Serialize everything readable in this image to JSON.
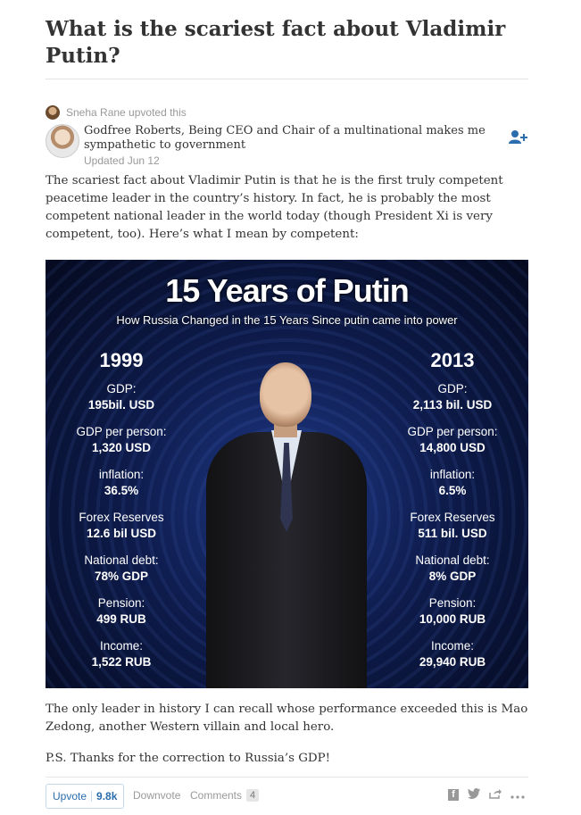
{
  "question": {
    "title": "What is the scariest fact about Vladimir Putin?"
  },
  "upvoter": {
    "text": "Sneha Rane upvoted this"
  },
  "answer": {
    "author_line": "Godfree Roberts, Being CEO and Chair of a multinational makes me sympathetic to government",
    "updated": "Updated Jun 12",
    "follow_icon": "add-person-icon",
    "paragraph_1": "The scariest fact about Vladimir Putin is that he is the first truly competent peacetime leader in the country’s history. In fact, he is probably the most competent national leader in the world today (though President Xi is very competent, too). Here’s what I mean by competent:",
    "paragraph_2": "The only leader in history I can recall whose performance exceeded this is Mao Zedong, another Western villain and local hero.",
    "paragraph_3": "P.S. Thanks for the correction to Russia’s GDP!"
  },
  "infographic": {
    "title": "15 Years of Putin",
    "subtitle": "How Russia Changed in the 15 Years Since putin came into power",
    "left": {
      "year": "1999",
      "stats": [
        {
          "label": "GDP:",
          "value": "195bil. USD"
        },
        {
          "label": "GDP per person:",
          "value": "1,320 USD"
        },
        {
          "label": "inflation:",
          "value": "36.5%"
        },
        {
          "label": "Forex Reserves",
          "value": "12.6 bil USD"
        },
        {
          "label": "National debt:",
          "value": "78% GDP"
        },
        {
          "label": "Pension:",
          "value": "499 RUB"
        },
        {
          "label": "Income:",
          "value": "1,522 RUB"
        }
      ]
    },
    "right": {
      "year": "2013",
      "stats": [
        {
          "label": "GDP:",
          "value": "2,113 bil. USD"
        },
        {
          "label": "GDP per person:",
          "value": "14,800 USD"
        },
        {
          "label": "inflation:",
          "value": "6.5%"
        },
        {
          "label": "Forex Reserves",
          "value": "511 bil. USD"
        },
        {
          "label": "National debt:",
          "value": "8% GDP"
        },
        {
          "label": "Pension:",
          "value": "10,000 RUB"
        },
        {
          "label": "Income:",
          "value": "29,940 RUB"
        }
      ]
    }
  },
  "actions": {
    "upvote_label": "Upvote",
    "upvote_count": "9.8k",
    "downvote_label": "Downvote",
    "comments_label": "Comments",
    "comments_count": "4",
    "share_icons": [
      "facebook-icon",
      "twitter-icon",
      "share-icon",
      "more-icon"
    ]
  },
  "colors": {
    "link_blue": "#2b6dad",
    "muted_gray": "#999999"
  }
}
